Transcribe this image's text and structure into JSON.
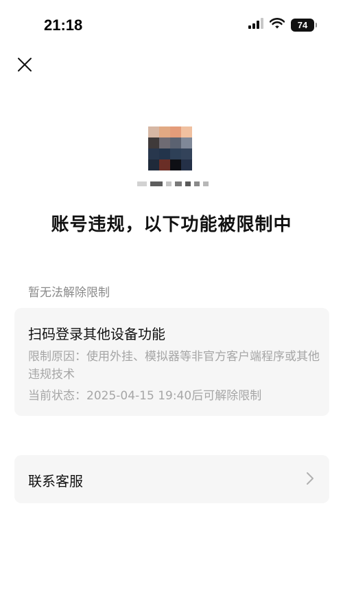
{
  "status_bar": {
    "time": "21:18",
    "battery": "74"
  },
  "icons": {
    "close": "close-icon",
    "signal": "cellular-signal-icon",
    "wifi": "wifi-icon",
    "battery": "battery-icon",
    "chevron": "chevron-right-icon"
  },
  "profile": {
    "avatar": "pixelated-avatar",
    "nickname": "pixelated-nickname"
  },
  "headline": "账号违规，以下功能被限制中",
  "section_label": "暂无法解除限制",
  "restriction": {
    "title": "扫码登录其他设备功能",
    "reason": "限制原因：使用外挂、模拟器等非官方客户端程序或其他违规技术",
    "status": "当前状态：2025-04-15 19:40后可解除限制"
  },
  "contact": {
    "label": "联系客服"
  },
  "colors": {
    "card_bg": "#f6f6f6",
    "muted_text": "#a6a6a6",
    "label_text": "#8a8a8a"
  }
}
